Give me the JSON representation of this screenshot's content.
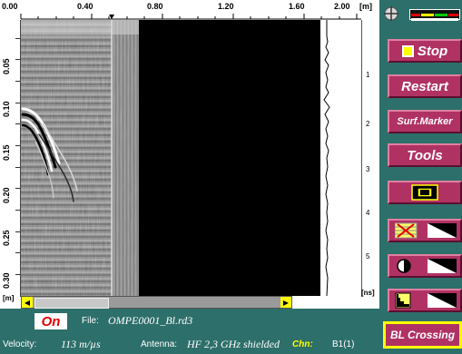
{
  "ruler": {
    "top_labels": [
      "0.00",
      "0.40",
      "0.80",
      "1.20",
      "1.60",
      "2.00"
    ],
    "top_unit": "[m]",
    "left_labels": [
      "0.05",
      "0.10",
      "0.15",
      "0.20",
      "0.25",
      "0.30"
    ],
    "left_unit": "[m]",
    "right_labels": [
      "1",
      "2",
      "3",
      "4",
      "5"
    ],
    "right_unit": "[ns]"
  },
  "buttons": {
    "stop": "Stop",
    "restart": "Restart",
    "surf_marker": "Surf.Marker",
    "tools": "Tools",
    "bl_crossing": "BL Crossing"
  },
  "icons": {
    "crosshair": "crosshair-icon",
    "meter": "signal-meter-icon",
    "stop": "stop-square-icon",
    "zoom": "zoom-frame-icon",
    "filter": "filter-icon",
    "contrast": "contrast-icon",
    "gain": "gain-curve-icon",
    "scroll_left": "arrow-left-icon",
    "scroll_right": "arrow-right-icon"
  },
  "status": {
    "on": "On",
    "file_label": "File:",
    "file_value": "OMPE0001_Bl.rd3",
    "velocity_label": "Velocity:",
    "velocity_value": "113 m/µs",
    "antenna_label": "Antenna:",
    "antenna_value": "HF 2,3 GHz shielded",
    "chn_label": "Chn:",
    "chn_value": "B1(1)"
  },
  "colors": {
    "panel": "#2d6f6a",
    "button": "#b03263",
    "accent": "#ffff00",
    "on_text": "#e00000"
  }
}
